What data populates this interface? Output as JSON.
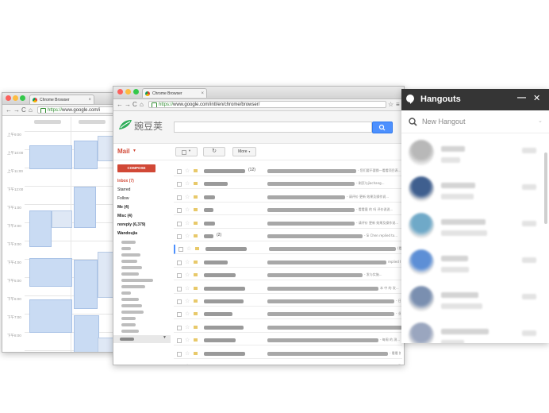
{
  "left_window": {
    "tab_label": "Chrome Browser",
    "url_https": "https://",
    "url_rest": "www.google.com/i",
    "time_labels": [
      "上午9:00",
      "上午10:00",
      "上午11:00",
      "下午12:00",
      "下午1:00",
      "下午2:00",
      "下午3:00",
      "下午4:00",
      "下午5:00",
      "下午6:00",
      "下午7:00",
      "下午8:00",
      "下午9:00"
    ]
  },
  "main_window": {
    "tab_label": "Chrome Browser",
    "url_https": "https://",
    "url_rest": "www.google.com/intl/en/chrome/browser/",
    "logo_text": "豌豆荚",
    "mail_label": "Mail",
    "compose_label": "COMPOSE",
    "more_label": "More",
    "nav": [
      "Inbox (7)",
      "Starred",
      "Follow",
      "Me (4)",
      "Misc (4)",
      "noreply (6,379)",
      "Wandoujia"
    ],
    "email_fragments": {
      "r0_count": "(12)",
      "r0_snip": "- 您们要不要换一看看项目表...",
      "r1_snip": "- 刷页与jiachang...",
      "r2_snip": "- 请评价 更新 效果及操作说...",
      "r3_snip": "- 看看量 的 吗 评价说说...",
      "r4_snip": "- 请评价 更新 效果及操作说...",
      "r5_count": "(2)",
      "r5_snip": "- Si Chen replied to...",
      "r6_snip": "(看, 2...",
      "r7_snip": "replied to...",
      "r8_snip": "- 发与实施...",
      "r9_snip": "本 中 的 发...",
      "r10_snip": "- 日 刊 的 进...",
      "r11_snip": "- 业务结果报告...",
      "r12_snip": "- 周 刊 发...",
      "r13_snip": "- 每周 的 测...",
      "r14_snip": "- 看看 推荐 发...",
      "r15_snip": "- 发与实施 ...",
      "r16_snip": "- 5 推 ..."
    }
  },
  "hangouts": {
    "title": "Hangouts",
    "search_placeholder": "New Hangout",
    "minimize_label": "—",
    "close_label": "✕",
    "contact_colors": [
      "#b8b8b8",
      "#3f5f8f",
      "#6fa9c8",
      "#5d8fd6",
      "#7a8fb0",
      "#9aa6bf"
    ]
  }
}
